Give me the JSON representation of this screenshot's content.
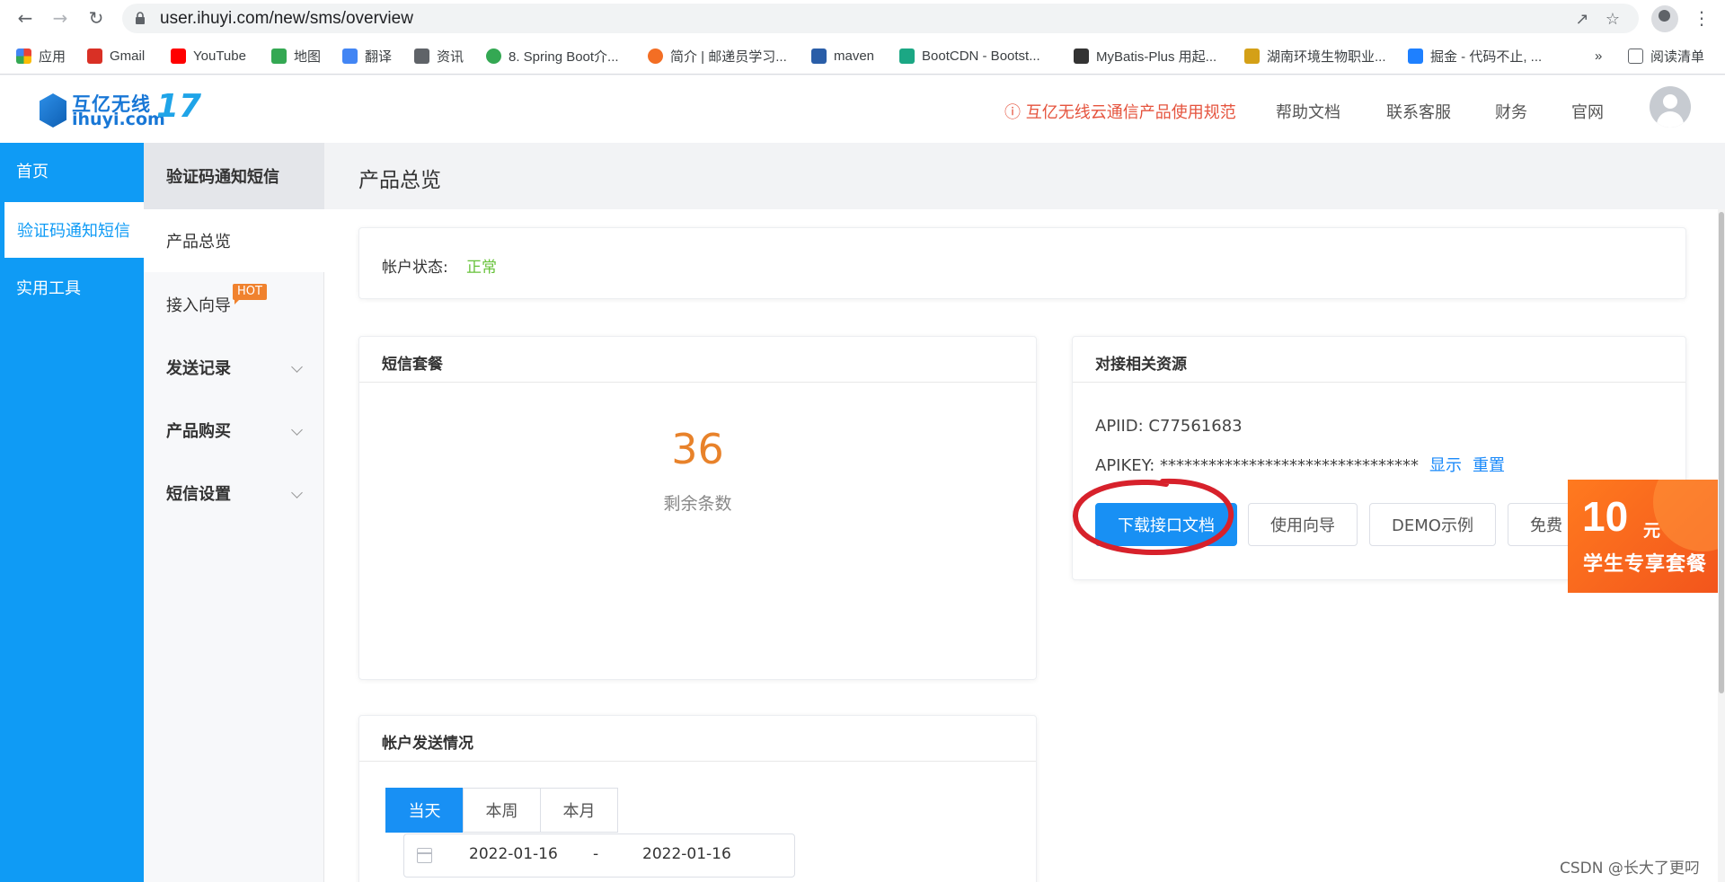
{
  "browser": {
    "url": "user.ihuyi.com/new/sms/overview",
    "bookmarks": [
      {
        "label": "应用",
        "color": "#ea4335"
      },
      {
        "label": "Gmail",
        "color": "#d93025"
      },
      {
        "label": "YouTube",
        "color": "#ff0000"
      },
      {
        "label": "地图",
        "color": "#34a853"
      },
      {
        "label": "翻译",
        "color": "#4285f4"
      },
      {
        "label": "资讯",
        "color": "#5f6368"
      },
      {
        "label": "8. Spring Boot介...",
        "color": "#34a853"
      },
      {
        "label": "简介 | 邮递员学习...",
        "color": "#f36e24"
      },
      {
        "label": "maven",
        "color": "#2a5ea8"
      },
      {
        "label": "BootCDN - Bootst...",
        "color": "#1ba784"
      },
      {
        "label": "MyBatis-Plus 用起...",
        "color": "#333333"
      },
      {
        "label": "湖南环境生物职业...",
        "color": "#d4a017"
      },
      {
        "label": "掘金 - 代码不止, ...",
        "color": "#1e80ff"
      }
    ],
    "more": "»",
    "reading_list": "阅读清单"
  },
  "header": {
    "logo_cn": "互亿无线",
    "logo_en": "ihuyi.com",
    "logo_num": "17",
    "warning_link": "互亿无线云通信产品使用规范",
    "links": [
      "帮助文档",
      "联系客服",
      "财务",
      "官网"
    ]
  },
  "main_nav": [
    "首页",
    "验证码通知短信",
    "实用工具"
  ],
  "sub_nav": {
    "heading": "验证码通知短信",
    "items": [
      "产品总览",
      "接入向导",
      "发送记录",
      "产品购买",
      "短信设置"
    ],
    "hot": "HOT"
  },
  "page": {
    "title": "产品总览",
    "status_label": "帐户状态:",
    "status_value": "正常"
  },
  "package_card": {
    "title": "短信套餐",
    "remaining": "36",
    "remaining_label": "剩余条数"
  },
  "resources_card": {
    "title": "对接相关资源",
    "apiid_line": "APIID: C77561683",
    "apikey_line": "APIKEY: ********************************",
    "show": "显示",
    "reset": "重置",
    "buttons": [
      "下载接口文档",
      "使用向导",
      "DEMO示例",
      "免费"
    ]
  },
  "promo": {
    "amount": "10",
    "unit": "元",
    "text": "学生专享套餐"
  },
  "send_card": {
    "title": "帐户发送情况",
    "tabs": [
      "当天",
      "本周",
      "本月"
    ],
    "date_start": "2022-01-16",
    "date_sep": "-",
    "date_end": "2022-01-16"
  },
  "watermark": "CSDN @长大了更叼",
  "colors": {
    "nav_blue": "#0f9bf5",
    "primary": "#1890f4",
    "link": "#1989fa",
    "status_ok": "#67c23a",
    "number_orange": "#e8822a",
    "warning": "#e5533d",
    "annotation_red": "#d7212b"
  }
}
